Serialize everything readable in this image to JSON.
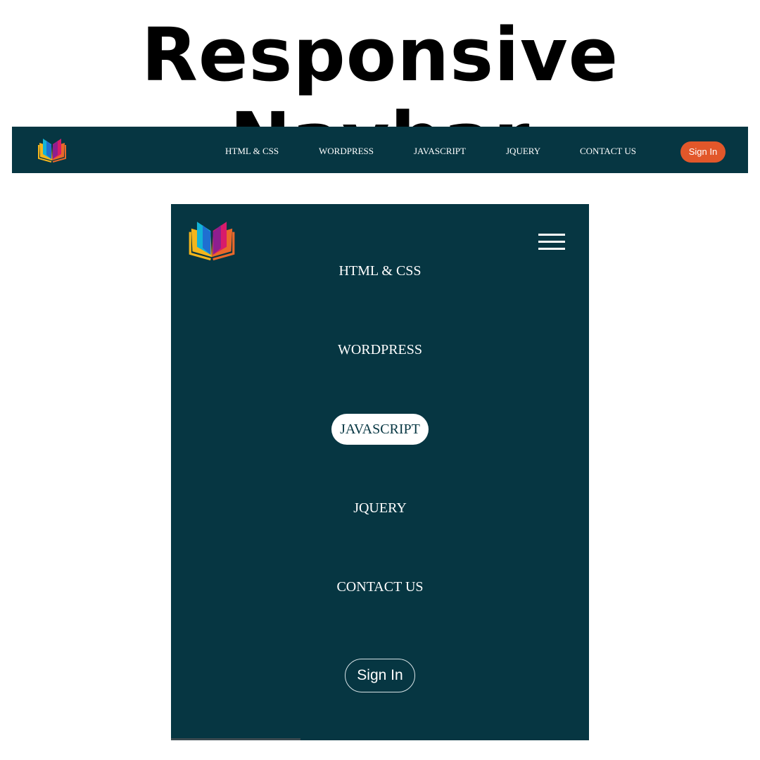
{
  "page": {
    "title": "Responsive Navbar"
  },
  "colors": {
    "navbar_bg": "#063642",
    "signin_accent": "#e2572a",
    "active_pill_bg": "#ffffff"
  },
  "desktop_nav": {
    "logo_icon": "open-book-logo-icon",
    "links": [
      "HTML & CSS",
      "WORDPRESS",
      "JAVASCRIPT",
      "JQUERY",
      "CONTACT US"
    ],
    "signin_label": "Sign In"
  },
  "mobile_nav": {
    "logo_icon": "open-book-logo-icon",
    "menu_icon": "hamburger-icon",
    "links": [
      "HTML & CSS",
      "WORDPRESS",
      "JAVASCRIPT",
      "JQUERY",
      "CONTACT US"
    ],
    "active_link": "JAVASCRIPT",
    "signin_label": "Sign In"
  }
}
